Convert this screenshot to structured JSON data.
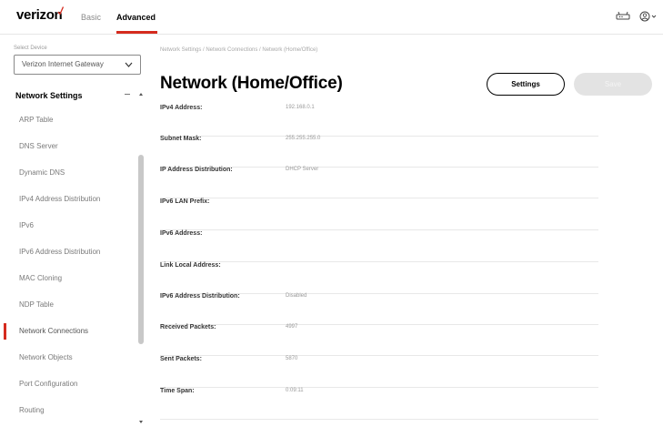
{
  "header": {
    "logo_text": "verizon",
    "nav": {
      "basic": "Basic",
      "advanced": "Advanced"
    },
    "brand_color": "#d52b1e",
    "icons": [
      "router-icon",
      "user-account-icon"
    ]
  },
  "sidebar": {
    "device_label": "Select Device",
    "device_value": "Verizon Internet Gateway",
    "section_title": "Network Settings",
    "items": [
      {
        "label": "ARP Table",
        "active": false
      },
      {
        "label": "DNS Server",
        "active": false
      },
      {
        "label": "Dynamic DNS",
        "active": false
      },
      {
        "label": "IPv4 Address Distribution",
        "active": false
      },
      {
        "label": "IPv6",
        "active": false
      },
      {
        "label": "IPv6 Address Distribution",
        "active": false
      },
      {
        "label": "MAC Cloning",
        "active": false
      },
      {
        "label": "NDP Table",
        "active": false
      },
      {
        "label": "Network Connections",
        "active": true
      },
      {
        "label": "Network Objects",
        "active": false
      },
      {
        "label": "Port Configuration",
        "active": false
      },
      {
        "label": "Routing",
        "active": false
      }
    ]
  },
  "main": {
    "breadcrumb": "Network Settings  /  Network Connections  /  Network (Home/Office)",
    "title": "Network (Home/Office)",
    "settings_label": "Settings",
    "save_label": "Save",
    "rows": [
      {
        "label": "IPv4 Address:",
        "value": "192.168.0.1"
      },
      {
        "label": "Subnet Mask:",
        "value": "255.255.255.0"
      },
      {
        "label": "IP Address Distribution:",
        "value": "DHCP Server"
      },
      {
        "label": "IPv6 LAN Prefix:",
        "value": ""
      },
      {
        "label": "IPv6 Address:",
        "value": ""
      },
      {
        "label": "Link Local Address:",
        "value": ""
      },
      {
        "label": "IPv6 Address Distribution:",
        "value": "Disabled"
      },
      {
        "label": "Received Packets:",
        "value": "4997"
      },
      {
        "label": "Sent Packets:",
        "value": "5870"
      },
      {
        "label": "Time Span:",
        "value": "0:09:11"
      }
    ]
  }
}
